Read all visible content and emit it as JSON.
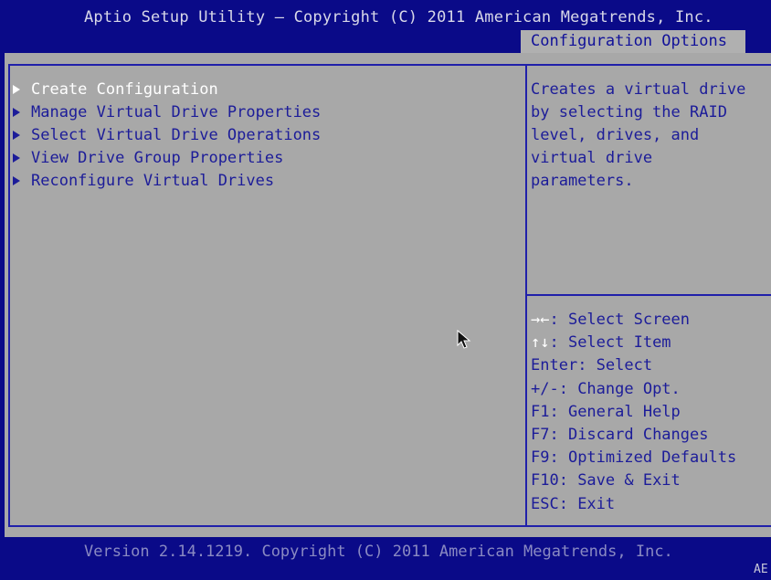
{
  "header": {
    "title": "Aptio Setup Utility – Copyright (C) 2011 American Megatrends, Inc.",
    "tab": "Configuration Options"
  },
  "menu": {
    "items": [
      {
        "label": "Create Configuration",
        "selected": true
      },
      {
        "label": "Manage Virtual Drive Properties",
        "selected": false
      },
      {
        "label": "Select Virtual Drive Operations",
        "selected": false
      },
      {
        "label": "View Drive Group Properties",
        "selected": false
      },
      {
        "label": "Reconfigure Virtual Drives",
        "selected": false
      }
    ]
  },
  "help": {
    "text": "Creates a virtual drive\nby selecting the RAID\nlevel, drives, and\nvirtual drive\nparameters."
  },
  "keys": [
    {
      "key": "→←",
      "desc": ": Select Screen"
    },
    {
      "key": "↑↓",
      "desc": ": Select Item"
    },
    {
      "key": "Enter",
      "desc": ": Select"
    },
    {
      "key": "+/-",
      "desc": ": Change Opt."
    },
    {
      "key": "F1",
      "desc": ": General Help"
    },
    {
      "key": "F7",
      "desc": ": Discard Changes"
    },
    {
      "key": "F9",
      "desc": ": Optimized Defaults"
    },
    {
      "key": "F10",
      "desc": ": Save & Exit"
    },
    {
      "key": "ESC",
      "desc": ": Exit"
    }
  ],
  "footer": {
    "version": "Version 2.14.1219. Copyright (C) 2011 American Megatrends, Inc.",
    "corner": "AE"
  },
  "colors": {
    "background": "#0a0a88",
    "panel": "#a8a8a8",
    "text": "#1c1c99",
    "highlight": "#ffffff"
  },
  "icons": {
    "menu_item": "right-triangle-icon",
    "pointer": "mouse-cursor-icon"
  }
}
